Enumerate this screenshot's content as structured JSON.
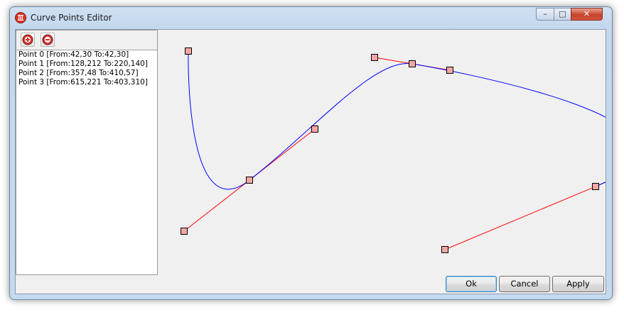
{
  "window": {
    "title": "Curve Points Editor"
  },
  "toolbar": {
    "add_icon": "add-circle-icon",
    "remove_icon": "remove-circle-icon"
  },
  "points": [
    {
      "label": "Point 0 [From:42,30 To:42,30]"
    },
    {
      "label": "Point 1 [From:128,212 To:220,140]"
    },
    {
      "label": "Point 2 [From:357,48 To:410,57]"
    },
    {
      "label": "Point 3 [From:615,221 To:403,310]"
    }
  ],
  "buttons": {
    "ok": "Ok",
    "cancel": "Cancel",
    "apply": "Apply"
  },
  "colors": {
    "curve": "#0000ff",
    "tangent": "#ff0000",
    "handle_fill": "#f4a6a6",
    "handle_stroke": "#000000"
  }
}
